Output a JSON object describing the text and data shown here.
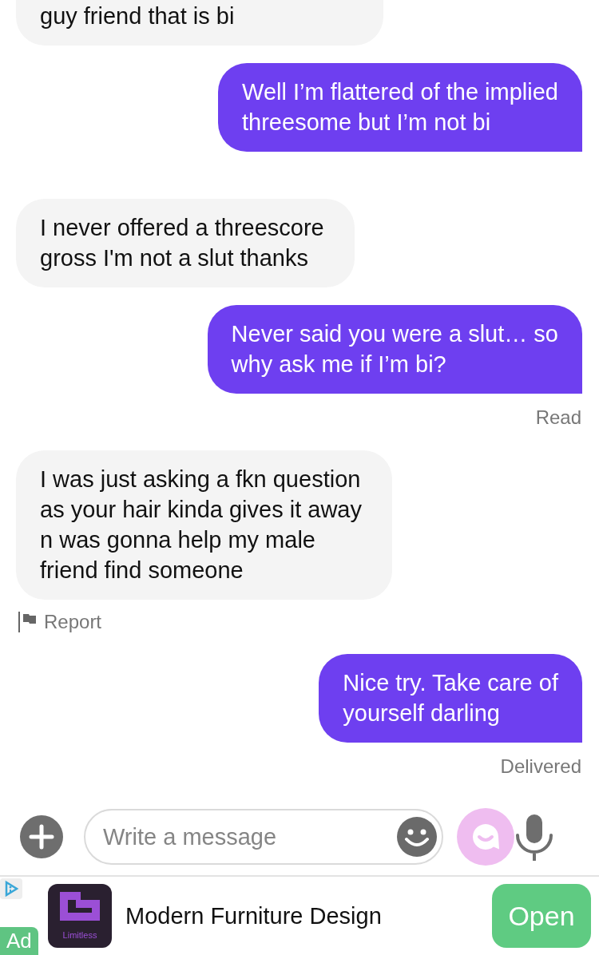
{
  "thread": [
    {
      "kind": "incoming",
      "text": "guy friend that is bi"
    },
    {
      "kind": "outgoing",
      "text": "Well I’m flattered of the implied\nthreesome but I’m not bi"
    },
    {
      "kind": "incoming",
      "text": "I never offered a threescore\ngross I'm not a slut thanks"
    },
    {
      "kind": "outgoing",
      "text": "Never said you were a slut… so\nwhy ask me if I’m bi?"
    },
    {
      "kind": "status",
      "text": "Read"
    },
    {
      "kind": "incoming",
      "text": "I was just asking a fkn question\nas your hair kinda gives it away\nn was gonna help my male\nfriend find someone"
    },
    {
      "kind": "report",
      "text": "Report"
    },
    {
      "kind": "outgoing",
      "text": "Nice try. Take care of\nyourself darling"
    },
    {
      "kind": "status",
      "text": "Delivered"
    }
  ],
  "composer": {
    "placeholder": "Write a message"
  },
  "ad": {
    "badge": "Ad",
    "logo_text": "Limitless",
    "title": "Modern Furniture Design",
    "button": "Open"
  }
}
